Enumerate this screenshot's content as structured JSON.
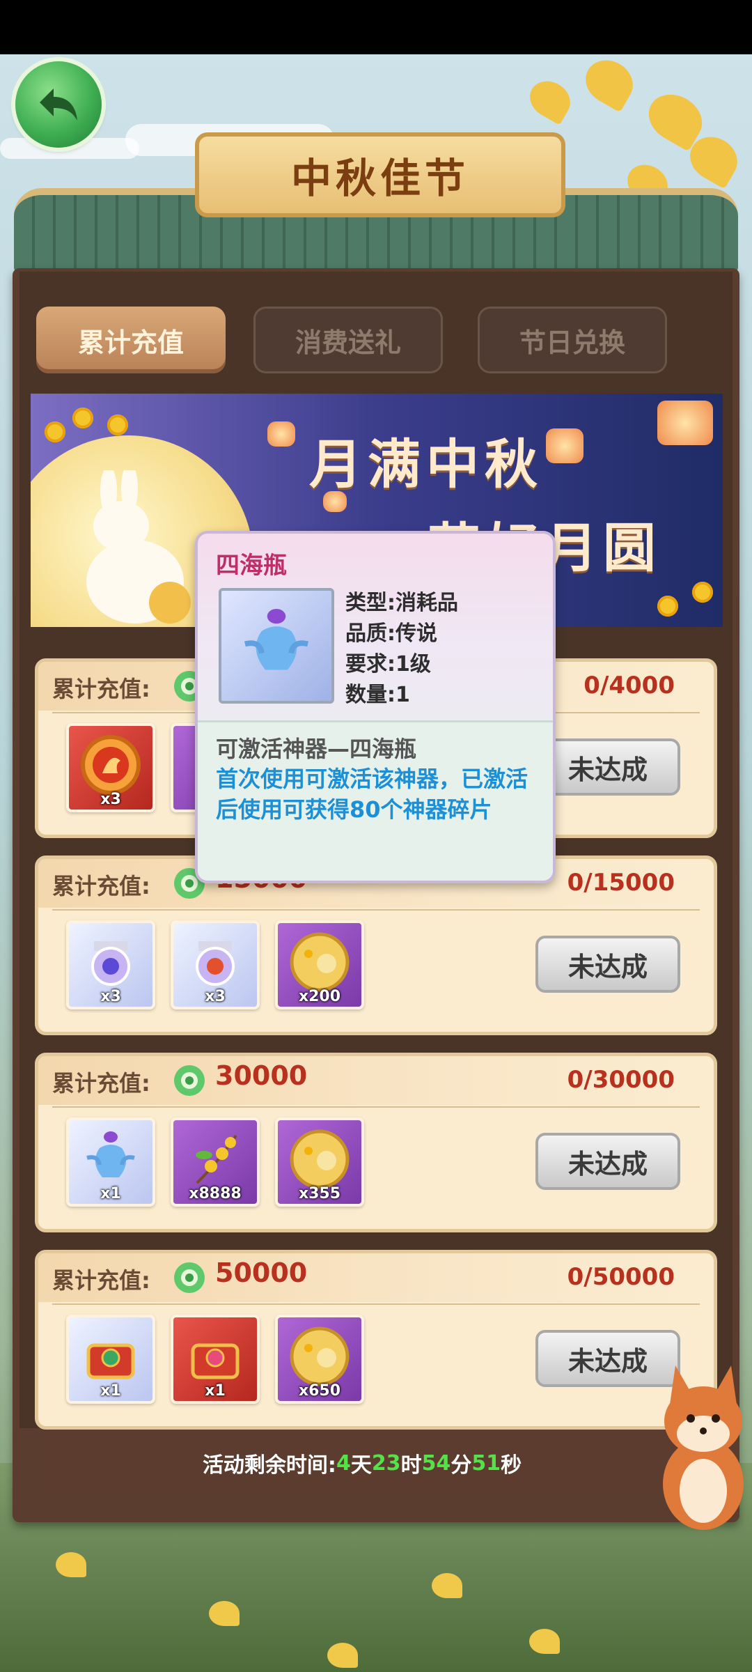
{
  "header": {
    "title": "中秋佳节"
  },
  "tabs": [
    {
      "label": "累计充值",
      "active": true
    },
    {
      "label": "消费送礼",
      "active": false
    },
    {
      "label": "节日兑换",
      "active": false
    }
  ],
  "banner": {
    "line1": "月满中秋",
    "line2": "花好月圆"
  },
  "reward_rows": [
    {
      "label": "累计充值:",
      "target": "",
      "progress": "0/4000",
      "status": "未达成",
      "items": [
        {
          "icon": "dragon-medal-icon",
          "count": "x3",
          "rarity": "red"
        },
        {
          "icon": "purple-item-icon",
          "count": "",
          "rarity": "purple"
        }
      ]
    },
    {
      "label": "累计充值:",
      "target": "15000",
      "progress": "0/15000",
      "status": "未达成",
      "items": [
        {
          "icon": "crown-mirror-blue-icon",
          "count": "x3",
          "rarity": "blue"
        },
        {
          "icon": "crown-mirror-red-icon",
          "count": "x3",
          "rarity": "blue"
        },
        {
          "icon": "mooncake-icon",
          "count": "x200",
          "rarity": "purple"
        }
      ]
    },
    {
      "label": "累计充值:",
      "target": "30000",
      "progress": "0/30000",
      "status": "未达成",
      "items": [
        {
          "icon": "sihai-vase-icon",
          "count": "x1",
          "rarity": "blue"
        },
        {
          "icon": "osmanthus-icon",
          "count": "x8888",
          "rarity": "purple"
        },
        {
          "icon": "mooncake-icon",
          "count": "x355",
          "rarity": "purple"
        }
      ]
    },
    {
      "label": "累计充值:",
      "target": "50000",
      "progress": "0/50000",
      "status": "未达成",
      "items": [
        {
          "icon": "treasure-chest-green-icon",
          "count": "x1",
          "rarity": "blue"
        },
        {
          "icon": "treasure-chest-red-icon",
          "count": "x1",
          "rarity": "red"
        },
        {
          "icon": "mooncake-icon",
          "count": "x650",
          "rarity": "purple"
        }
      ]
    }
  ],
  "footer": {
    "label": "活动剩余时间:",
    "days": "4",
    "days_unit": "天",
    "hours": "23",
    "hours_unit": "时",
    "minutes": "54",
    "minutes_unit": "分",
    "seconds": "51",
    "seconds_unit": "秒"
  },
  "tooltip": {
    "name": "四海瓶",
    "icon": "sihai-vase-icon",
    "stats": [
      {
        "key": "类型:",
        "value": "消耗品"
      },
      {
        "key": "品质:",
        "value": "传说"
      },
      {
        "key": "要求:",
        "value": "1级"
      },
      {
        "key": "数量:",
        "value": "1"
      }
    ],
    "desc_title": "可激活神器—四海瓶",
    "desc": "首次使用可激活该神器，已激活后使用可获得80个神器碎片"
  },
  "colors": {
    "progress_red": "#b8301e",
    "timer_green": "#56e04a",
    "tooltip_name": "#c02e6a",
    "tooltip_desc": "#1d8fd4"
  }
}
